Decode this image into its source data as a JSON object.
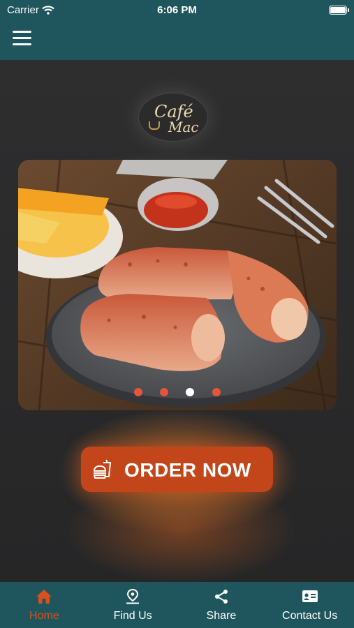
{
  "status_bar": {
    "carrier": "Carrier",
    "time": "6:06 PM"
  },
  "header": {
    "menu_icon": "hamburger-icon"
  },
  "logo": {
    "line1": "Café",
    "line2": "Mac"
  },
  "carousel": {
    "slide_count": 4,
    "active_index": 2
  },
  "order_button": {
    "label": "ORDER NOW",
    "icon": "takeaway-food-icon"
  },
  "tabs": [
    {
      "label": "Home",
      "icon": "home-icon",
      "active": true
    },
    {
      "label": "Find Us",
      "icon": "location-pin-icon",
      "active": false
    },
    {
      "label": "Share",
      "icon": "share-icon",
      "active": false
    },
    {
      "label": "Contact Us",
      "icon": "contact-card-icon",
      "active": false
    }
  ],
  "colors": {
    "header": "#1f565d",
    "accent": "#c3451a",
    "active_tab": "#d9501d",
    "background": "#2a2a2b"
  }
}
